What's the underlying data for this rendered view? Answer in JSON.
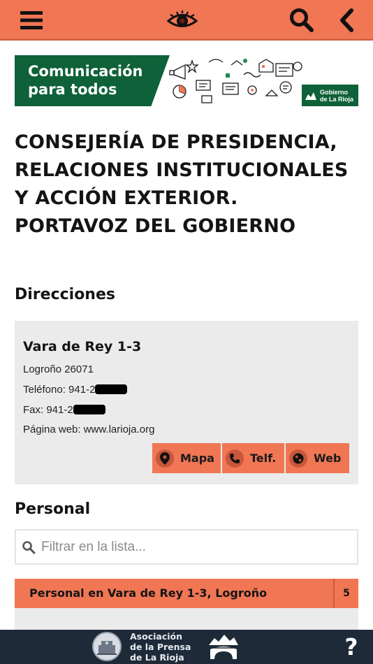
{
  "header": {
    "menu_icon": "hamburger-menu-icon",
    "logo_icon": "eye-icon",
    "search_icon": "search-icon",
    "back_icon": "chevron-left-icon",
    "color": "#f07654"
  },
  "banner": {
    "line1": "Comunicación",
    "line2": "para todos",
    "logo_line1": "Gobierno",
    "logo_line2": "de La Rioja"
  },
  "page": {
    "title_lines": [
      "CONSEJERÍA DE PRESIDENCIA,",
      "RELACIONES INSTITUCIONALES",
      "Y ACCIÓN EXTERIOR.",
      "PORTAVOZ DEL GOBIERNO"
    ]
  },
  "directions": {
    "section_title": "Direcciones",
    "address": {
      "name": "Vara de Rey 1-3",
      "city_line": "Logroño 26071",
      "phone_label": "Teléfono: 941-2",
      "fax_label": "Fax: 941-2",
      "web_line": "Página web: www.larioja.org"
    },
    "buttons": {
      "map": "Mapa",
      "phone": "Telf.",
      "web": "Web"
    }
  },
  "personal": {
    "section_title": "Personal",
    "filter_placeholder": "Filtrar en la lista...",
    "group_label": "Personal en Vara de Rey 1-3, Logroño",
    "group_count": "5"
  },
  "footer": {
    "association_line1": "Asociación",
    "association_line2": "de la Prensa",
    "association_line3": "de La Rioja",
    "help_icon": "question-mark-icon",
    "background": "#1e2a38"
  },
  "colors": {
    "accent": "#f07654",
    "accent_dark": "#c8573b",
    "card_bg": "#ebebeb",
    "banner_green": "#0e6138"
  }
}
